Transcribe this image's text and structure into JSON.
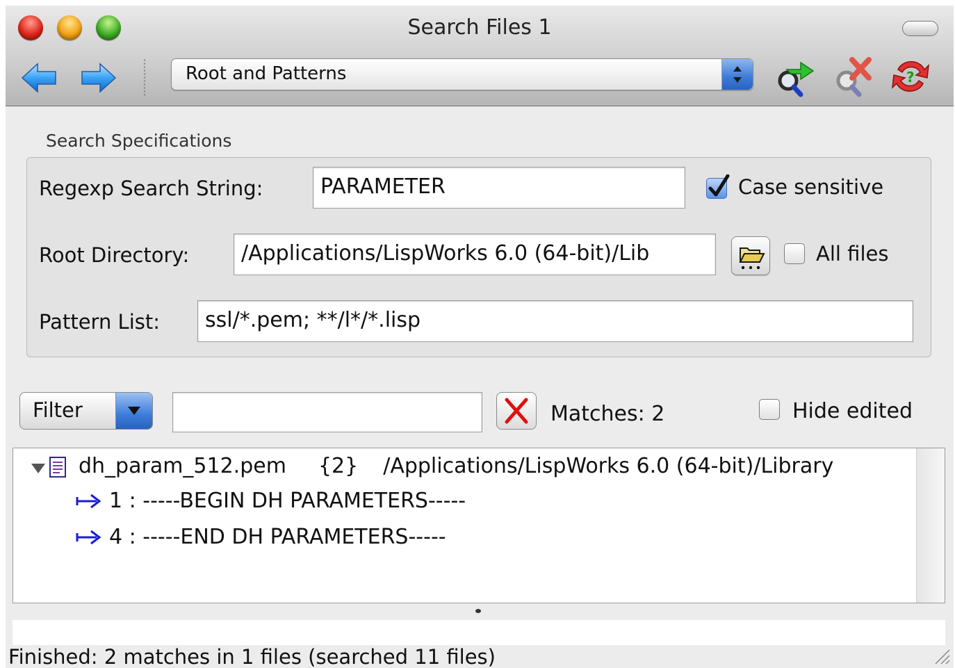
{
  "window": {
    "title": "Search Files 1"
  },
  "toolbar": {
    "back_icon": "arrow-left-icon",
    "forward_icon": "arrow-right-icon",
    "view_selector": "Root and Patterns",
    "search_icon": "search-go-icon",
    "cancel_icon": "search-cancel-icon",
    "refresh_icon": "refresh-icon"
  },
  "spec": {
    "group_label": "Search Specifications",
    "regexp_label": "Regexp Search String:",
    "regexp_value": "PARAMETER",
    "case_sensitive_label": "Case sensitive",
    "case_sensitive_checked": true,
    "root_label": "Root Directory:",
    "root_value": "/Applications/LispWorks 6.0 (64-bit)/Lib",
    "all_files_label": "All files",
    "all_files_checked": false,
    "pattern_label": "Pattern List:",
    "pattern_value": "ssl/*.pem; **/l*/*.lisp"
  },
  "filter": {
    "button_label": "Filter",
    "input_value": "",
    "matches_text": "Matches:  2",
    "hide_edited_label": "Hide edited",
    "hide_edited_checked": false
  },
  "results": {
    "file": {
      "name": "dh_param_512.pem",
      "count": "{2}",
      "path": "/Applications/LispWorks 6.0 (64-bit)/Library"
    },
    "matches": [
      {
        "text": "1 : -----BEGIN DH PARAMETERS-----"
      },
      {
        "text": "4 : -----END DH PARAMETERS-----"
      }
    ]
  },
  "status": {
    "text": "Finished:  2 matches in 1 files (searched 11 files)"
  },
  "colors": {
    "accent_blue": "#2d6fd6",
    "clear_red": "#e01010",
    "match_arrow": "#1a1adb"
  }
}
